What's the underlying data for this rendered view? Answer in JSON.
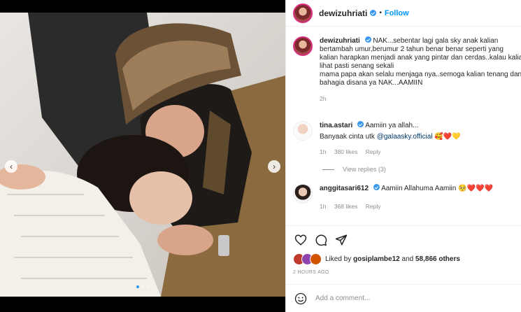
{
  "post": {
    "username": "dewizuhriati",
    "follow_label": "Follow",
    "separator": "•"
  },
  "caption": {
    "username": "dewizuhriati",
    "lines": [
      "NAK...sebentar lagi gala sky anak kalian",
      "bertambah umur,berumur 2 tahun benar benar seperti yang",
      "kalian harapkan menjadi anak yang pintar dan cerdas..kalau kalian",
      "lihat pasti senang sekali",
      "mama papa akan selalu menjaga nya..semoga kalian tenang dan",
      "bahagia disana ya NAK...AAMIIN"
    ],
    "time": "2h"
  },
  "comments": [
    {
      "username": "tina.astari",
      "line1": "Aamiin ya allah...",
      "line2_prefix": "Banyaak cinta utk ",
      "mention": "@galaasky.official",
      "emojis": "🥰❤️💛",
      "time": "1h",
      "likes": "380 likes",
      "reply": "Reply",
      "view_replies": "View replies (3)"
    },
    {
      "username": "anggitasari612",
      "text": "Aamiin Allahuma Aamiin",
      "emojis": "🥺❤️❤️❤️",
      "time": "1h",
      "likes": "368 likes",
      "reply": "Reply"
    }
  ],
  "likes": {
    "prefix": "Liked by ",
    "user": "gosiplambe12",
    "middle": " and ",
    "count": "58,866 others"
  },
  "timestamp": "2 HOURS AGO",
  "add_comment_placeholder": "Add a comment...",
  "colors": {
    "link_blue": "#0095f6",
    "verified_blue": "#3897f0",
    "muted": "#8e8e8e",
    "text": "#262626"
  },
  "carousel": {
    "dots": 3,
    "active_dot": 1
  }
}
